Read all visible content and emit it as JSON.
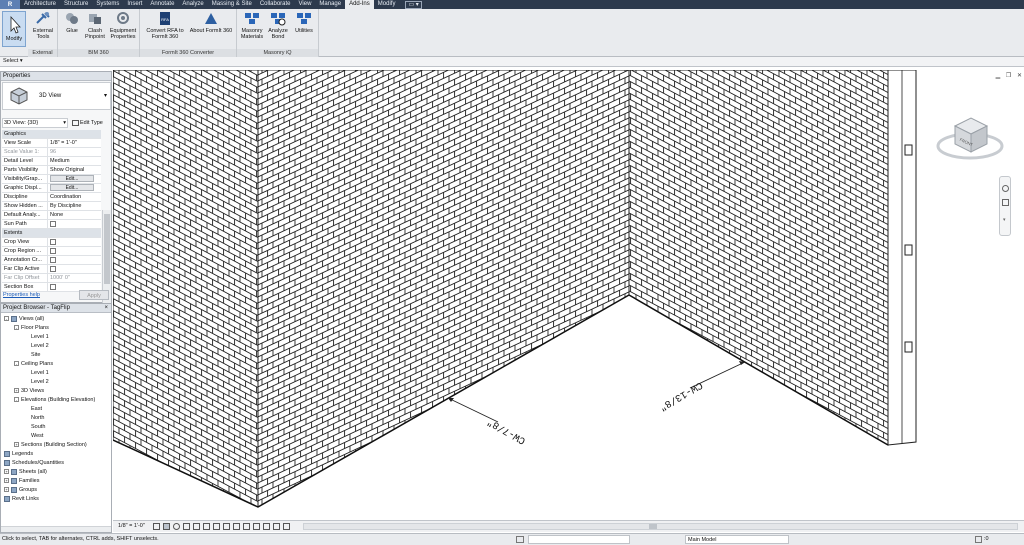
{
  "app": {
    "button_label": "R"
  },
  "tabs": [
    "Architecture",
    "Structure",
    "Systems",
    "Insert",
    "Annotate",
    "Analyze",
    "Massing & Site",
    "Collaborate",
    "View",
    "Manage",
    "Add-Ins",
    "Modify"
  ],
  "active_tab": "Add-Ins",
  "ribbon": {
    "modify": "Modify",
    "external": {
      "tools_label": "External Tools",
      "panel_label": "External"
    },
    "bim360": {
      "glue": "Glue",
      "clash": "Clash Pinpoint",
      "equipment": "Equipment Properties",
      "panel_label": "BIM 360"
    },
    "formit": {
      "convert": "Convert RFA to FormIt 360",
      "about": "About FormIt 360",
      "panel_label": "FormIt 360 Converter"
    },
    "masonry": {
      "materials": "Masonry Materials",
      "analyze": "Analyze Bond",
      "utilities": "Utilities",
      "panel_label": "Masonry iQ"
    }
  },
  "optbar": {
    "select": "Select",
    "select_arrow": "▾"
  },
  "properties": {
    "title": "Properties",
    "type_name": "3D View",
    "view_selector": "3D View: {3D}",
    "edit_type": "Edit Type",
    "rows": [
      {
        "k": "Graphics",
        "v": "",
        "sec": true
      },
      {
        "k": "View Scale",
        "v": "1/8\" = 1'-0\""
      },
      {
        "k": "Scale Value 1:",
        "v": "96",
        "grey": true
      },
      {
        "k": "Detail Level",
        "v": "Medium"
      },
      {
        "k": "Parts Visibility",
        "v": "Show Original"
      },
      {
        "k": "Visibility/Grap...",
        "v": "Edit...",
        "btn": true
      },
      {
        "k": "Graphic Displ...",
        "v": "Edit...",
        "btn": true
      },
      {
        "k": "Discipline",
        "v": "Coordination"
      },
      {
        "k": "Show Hidden ...",
        "v": "By Discipline"
      },
      {
        "k": "Default Analy...",
        "v": "None"
      },
      {
        "k": "Sun Path",
        "v": "",
        "cb": true
      },
      {
        "k": "Extents",
        "v": "",
        "sec": true
      },
      {
        "k": "Crop View",
        "v": "",
        "cb": true
      },
      {
        "k": "Crop Region ...",
        "v": "",
        "cb": true
      },
      {
        "k": "Annotation Cr...",
        "v": "",
        "cb": true
      },
      {
        "k": "Far Clip Active",
        "v": "",
        "cb": true
      },
      {
        "k": "Far Clip Offset",
        "v": "1000' 0\"",
        "grey": true
      },
      {
        "k": "Section Box",
        "v": "",
        "cb": true
      }
    ],
    "help": "Properties help",
    "apply": "Apply"
  },
  "browser": {
    "title": "Project Browser - TagFlip",
    "items": [
      {
        "t": "Views (all)",
        "lvl": 0,
        "exp": "-",
        "icon": true
      },
      {
        "t": "Floor Plans",
        "lvl": 1,
        "exp": "-"
      },
      {
        "t": "Level 1",
        "lvl": 2
      },
      {
        "t": "Level 2",
        "lvl": 2
      },
      {
        "t": "Site",
        "lvl": 2
      },
      {
        "t": "Ceiling Plans",
        "lvl": 1,
        "exp": "-"
      },
      {
        "t": "Level 1",
        "lvl": 2
      },
      {
        "t": "Level 2",
        "lvl": 2
      },
      {
        "t": "3D Views",
        "lvl": 1,
        "exp": "+"
      },
      {
        "t": "Elevations (Building Elevation)",
        "lvl": 1,
        "exp": "-"
      },
      {
        "t": "East",
        "lvl": 2
      },
      {
        "t": "North",
        "lvl": 2
      },
      {
        "t": "South",
        "lvl": 2
      },
      {
        "t": "West",
        "lvl": 2
      },
      {
        "t": "Sections (Building Section)",
        "lvl": 1,
        "exp": "+"
      },
      {
        "t": "Legends",
        "lvl": 0,
        "icon": true
      },
      {
        "t": "Schedules/Quantities",
        "lvl": 0,
        "icon": true
      },
      {
        "t": "Sheets (all)",
        "lvl": 0,
        "exp": "+",
        "icon": true
      },
      {
        "t": "Families",
        "lvl": 0,
        "exp": "+",
        "icon": true
      },
      {
        "t": "Groups",
        "lvl": 0,
        "exp": "+",
        "icon": true
      },
      {
        "t": "Revit Links",
        "lvl": 0,
        "icon": true
      }
    ]
  },
  "view": {
    "scale": "1/8\" = 1'-0\"",
    "tag1": "CW-7/8\"",
    "tag2": "CW-13/8\""
  },
  "viewcube": {
    "front": "FRONT"
  },
  "status": {
    "text": "Click to select, TAB for alternates, CTRL adds, SHIFT unselects.",
    "model": "Main Model",
    "count": ":0"
  }
}
